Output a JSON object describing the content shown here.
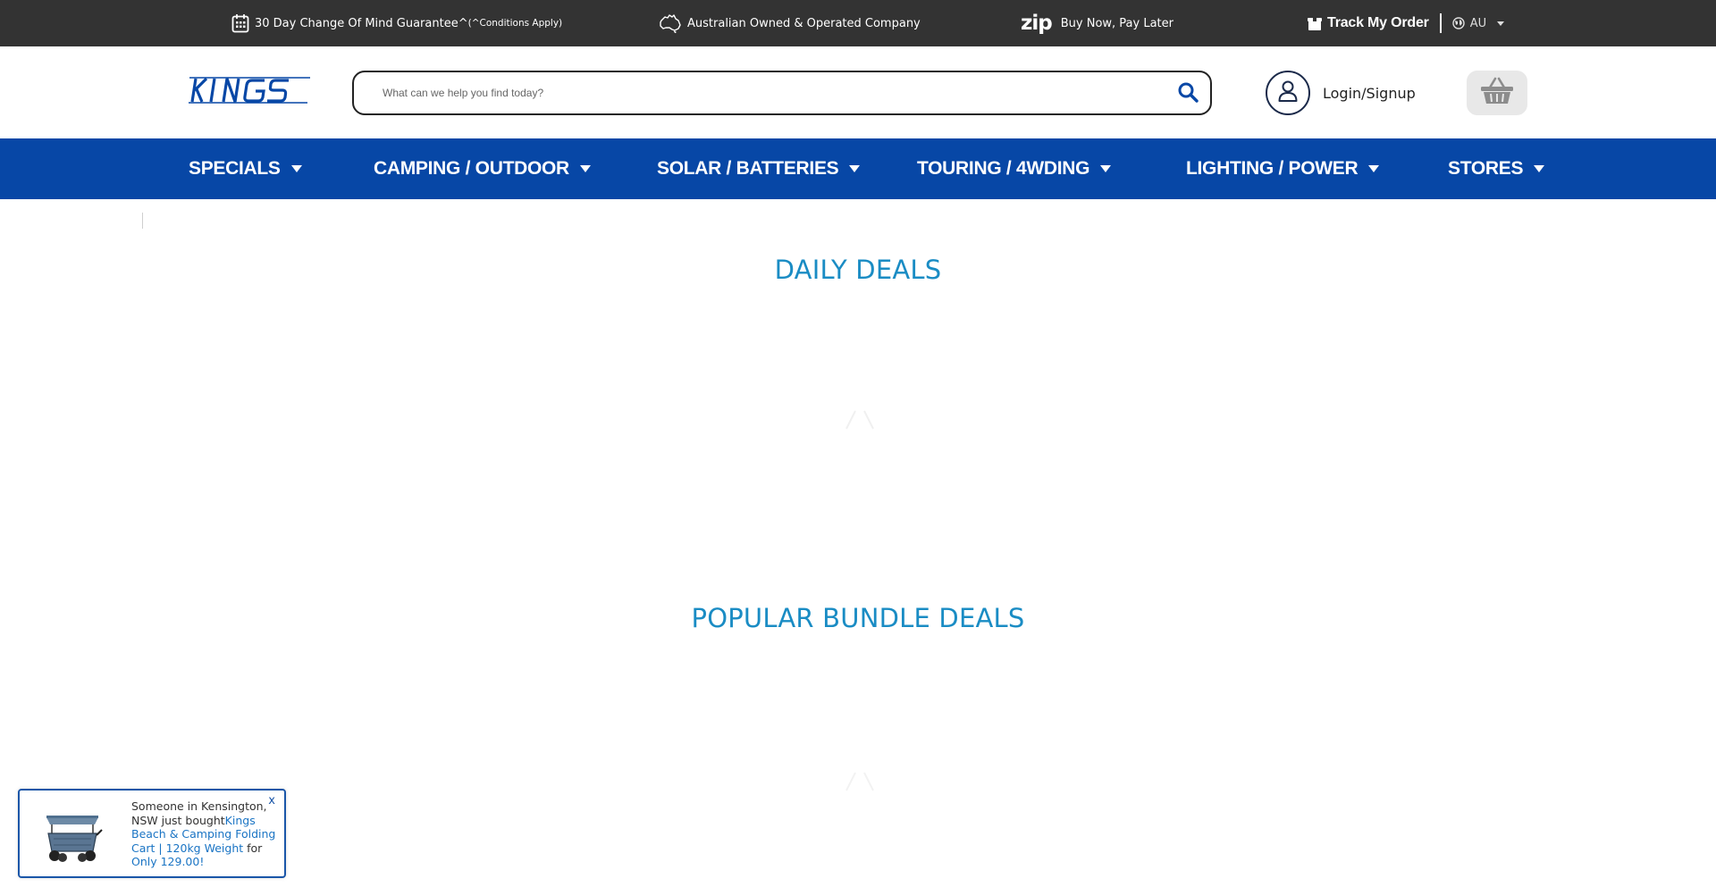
{
  "topbar": {
    "guarantee_text": "30 Day Change Of Mind Guarantee^",
    "guarantee_conditions": "(^Conditions Apply)",
    "aussie_text": "Australian Owned & Operated Company",
    "zip_logo": "zip",
    "zip_text": "Buy Now, Pay Later",
    "track_order": "Track My Order",
    "region": "AU"
  },
  "header": {
    "logo_text": "KINGS",
    "search_placeholder": "What can we help you find today?",
    "login_label": "Login/Signup"
  },
  "nav": {
    "items": [
      {
        "label": "SPECIALS"
      },
      {
        "label": "CAMPING / OUTDOOR"
      },
      {
        "label": "SOLAR / BATTERIES"
      },
      {
        "label": "TOURING / 4WDING"
      },
      {
        "label": "LIGHTING / POWER"
      },
      {
        "label": "STORES"
      }
    ]
  },
  "main": {
    "daily_deals_title": "DAILY DEALS",
    "bundle_deals_title": "POPULAR BUNDLE DEALS"
  },
  "popup": {
    "prefix": "Someone in Kensington, NSW just bought",
    "product": "Kings Beach & Camping Folding Cart | 120kg Weight",
    "mid": " for ",
    "price": "Only 129.00!",
    "close": "x"
  },
  "colors": {
    "topbar_bg": "#333333",
    "nav_bg": "#0747a6",
    "title_blue": "#1a8cc4",
    "link_blue": "#1a74c4"
  }
}
